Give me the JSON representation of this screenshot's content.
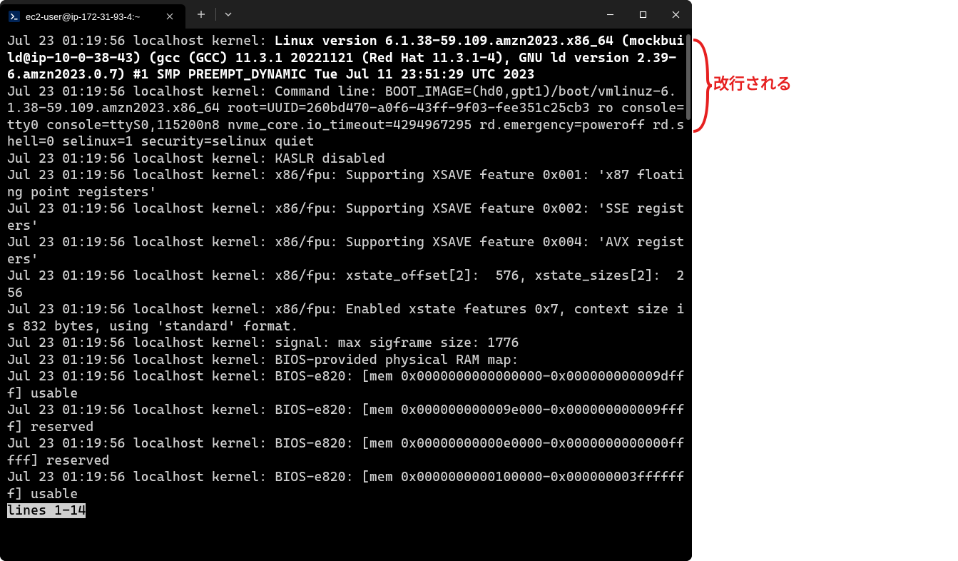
{
  "titlebar": {
    "tab_title": "ec2-user@ip-172-31-93-4:~",
    "tab_icon_label": "powershell-icon"
  },
  "terminal": {
    "lines": [
      {
        "text": "Jul 23 01:19:56 localhost kernel: ",
        "bold_suffix": "Linux version 6.1.38-59.109.amzn2023.x86_64 (mockbuild@ip-10-0-38-43) (gcc (GCC) 11.3.1 20221121 (Red Hat 11.3.1-4), GNU ld version 2.39-6.amzn2023.0.7) #1 SMP PREEMPT_DYNAMIC Tue Jul 11 23:51:29 UTC 2023"
      },
      {
        "text": "Jul 23 01:19:56 localhost kernel: Command line: BOOT_IMAGE=(hd0,gpt1)/boot/vmlinuz-6.1.38-59.109.amzn2023.x86_64 root=UUID=260bd470-a0f6-43ff-9f03-fee351c25cb3 ro console=tty0 console=ttyS0,115200n8 nvme_core.io_timeout=4294967295 rd.emergency=poweroff rd.shell=0 selinux=1 security=selinux quiet"
      },
      {
        "text": "Jul 23 01:19:56 localhost kernel: KASLR disabled"
      },
      {
        "text": "Jul 23 01:19:56 localhost kernel: x86/fpu: Supporting XSAVE feature 0x001: 'x87 floating point registers'"
      },
      {
        "text": "Jul 23 01:19:56 localhost kernel: x86/fpu: Supporting XSAVE feature 0x002: 'SSE registers'"
      },
      {
        "text": "Jul 23 01:19:56 localhost kernel: x86/fpu: Supporting XSAVE feature 0x004: 'AVX registers'"
      },
      {
        "text": "Jul 23 01:19:56 localhost kernel: x86/fpu: xstate_offset[2]:  576, xstate_sizes[2]:  256"
      },
      {
        "text": "Jul 23 01:19:56 localhost kernel: x86/fpu: Enabled xstate features 0x7, context size is 832 bytes, using 'standard' format."
      },
      {
        "text": "Jul 23 01:19:56 localhost kernel: signal: max sigframe size: 1776"
      },
      {
        "text": "Jul 23 01:19:56 localhost kernel: BIOS-provided physical RAM map:"
      },
      {
        "text": "Jul 23 01:19:56 localhost kernel: BIOS-e820: [mem 0x0000000000000000-0x000000000009dfff] usable"
      },
      {
        "text": "Jul 23 01:19:56 localhost kernel: BIOS-e820: [mem 0x000000000009e000-0x000000000009ffff] reserved"
      },
      {
        "text": "Jul 23 01:19:56 localhost kernel: BIOS-e820: [mem 0x00000000000e0000-0x0000000000000fffff] reserved"
      },
      {
        "text": "Jul 23 01:19:56 localhost kernel: BIOS-e820: [mem 0x0000000000100000-0x000000003fffffff] usable"
      }
    ],
    "status": "lines 1-14"
  },
  "annotation": {
    "text": "改行される"
  }
}
